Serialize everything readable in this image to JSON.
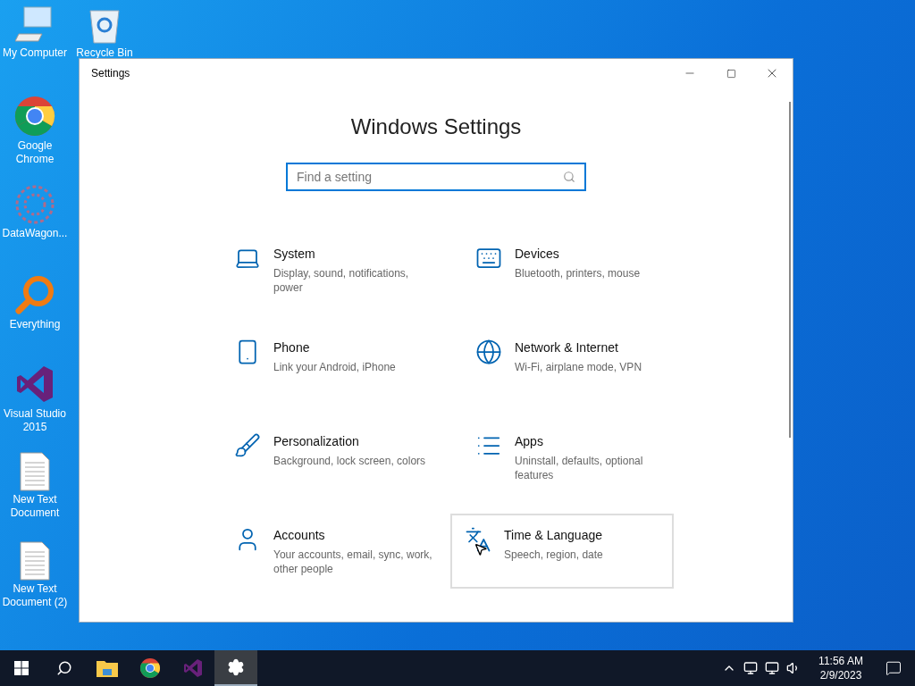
{
  "desktop_icons": [
    {
      "kind": "computer",
      "label": "My Computer"
    },
    {
      "kind": "recycle",
      "label": "Recycle Bin"
    },
    {
      "kind": "chrome",
      "label": "Google Chrome"
    },
    {
      "kind": "datawagon",
      "label": "DataWagon..."
    },
    {
      "kind": "everything",
      "label": "Everything"
    },
    {
      "kind": "vs",
      "label": "Visual Studio 2015"
    },
    {
      "kind": "text",
      "label": "New Text Document"
    },
    {
      "kind": "text",
      "label": "New Text Document (2)"
    }
  ],
  "window": {
    "title": "Settings",
    "heading": "Windows Settings",
    "search": {
      "placeholder": "Find a setting"
    },
    "tiles": [
      {
        "kind": "system",
        "title": "System",
        "description": "Display, sound, notifications, power",
        "highlighted": false
      },
      {
        "kind": "devices",
        "title": "Devices",
        "description": "Bluetooth, printers, mouse",
        "highlighted": false
      },
      {
        "kind": "phone",
        "title": "Phone",
        "description": "Link your Android, iPhone",
        "highlighted": false
      },
      {
        "kind": "network",
        "title": "Network & Internet",
        "description": "Wi-Fi, airplane mode, VPN",
        "highlighted": false
      },
      {
        "kind": "personalization",
        "title": "Personalization",
        "description": "Background, lock screen, colors",
        "highlighted": false
      },
      {
        "kind": "apps",
        "title": "Apps",
        "description": "Uninstall, defaults, optional features",
        "highlighted": false
      },
      {
        "kind": "accounts",
        "title": "Accounts",
        "description": "Your accounts, email, sync, work, other people",
        "highlighted": false
      },
      {
        "kind": "time",
        "title": "Time & Language",
        "description": "Speech, region, date",
        "highlighted": true
      }
    ]
  },
  "taskbar": {
    "apps": [
      {
        "kind": "explorer",
        "selected": false
      },
      {
        "kind": "chrome",
        "selected": false
      },
      {
        "kind": "vs",
        "selected": false
      },
      {
        "kind": "settings",
        "selected": true
      }
    ],
    "time": "11:56 AM",
    "date": "2/9/2023"
  }
}
